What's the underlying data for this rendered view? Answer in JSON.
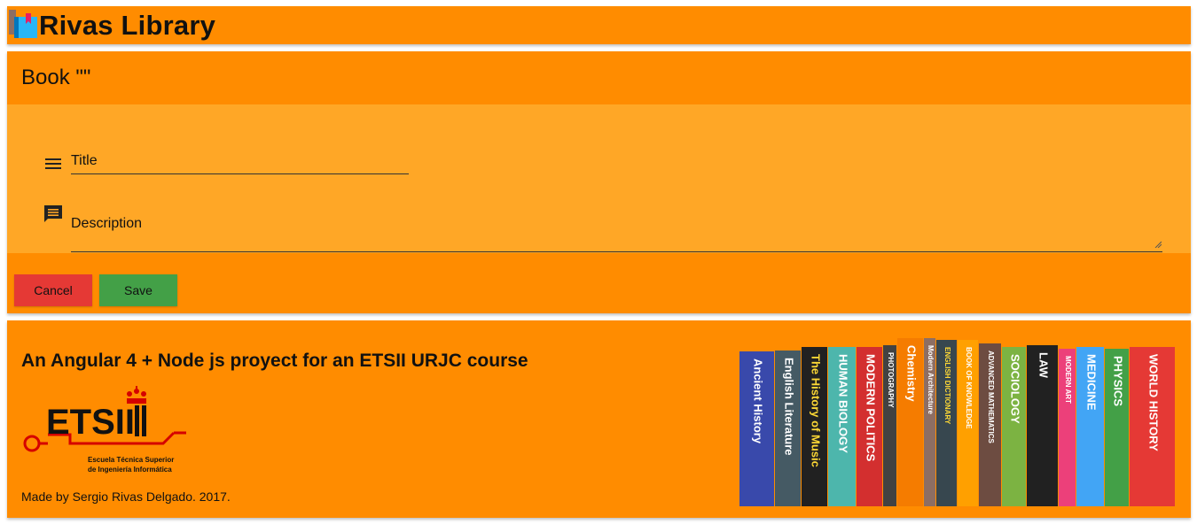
{
  "header": {
    "app_title": "Rivas Library",
    "logo_icon": "book-stack-icon"
  },
  "card": {
    "title": "Book \"\"",
    "fields": {
      "title_placeholder": "Title",
      "title_icon": "menu-lines-icon",
      "description_placeholder": "Description",
      "description_icon": "comment-icon"
    },
    "actions": {
      "cancel_label": "Cancel",
      "save_label": "Save"
    }
  },
  "footer": {
    "heading": "An Angular 4 + Node js proyect for an ETSII URJC course",
    "etsii_logo": {
      "acronym": "ETSII",
      "line1": "Escuela Técnica Superior",
      "line2": "de Ingeniería Informática"
    },
    "credits": "Made by Sergio Rivas Delgado. 2017.",
    "books": [
      "Ancient History",
      "English Literature",
      "The History of Music",
      "HUMAN BIOLOGY",
      "MODERN POLITICS",
      "PHOTOGRAPHY",
      "Chemistry",
      "Modern Architecture",
      "ENGLISH DICTIONARY",
      "BOOK OF KNOWLEDGE",
      "ADVANCED MATHEMATICS",
      "SOCIOLOGY",
      "LAW",
      "MODERN ART",
      "MEDICINE",
      "PHYSICS",
      "WORLD HISTORY"
    ]
  },
  "colors": {
    "primary": "#ff8c00",
    "card_body": "#ffa726",
    "cancel": "#e53935",
    "save": "#43a047"
  }
}
